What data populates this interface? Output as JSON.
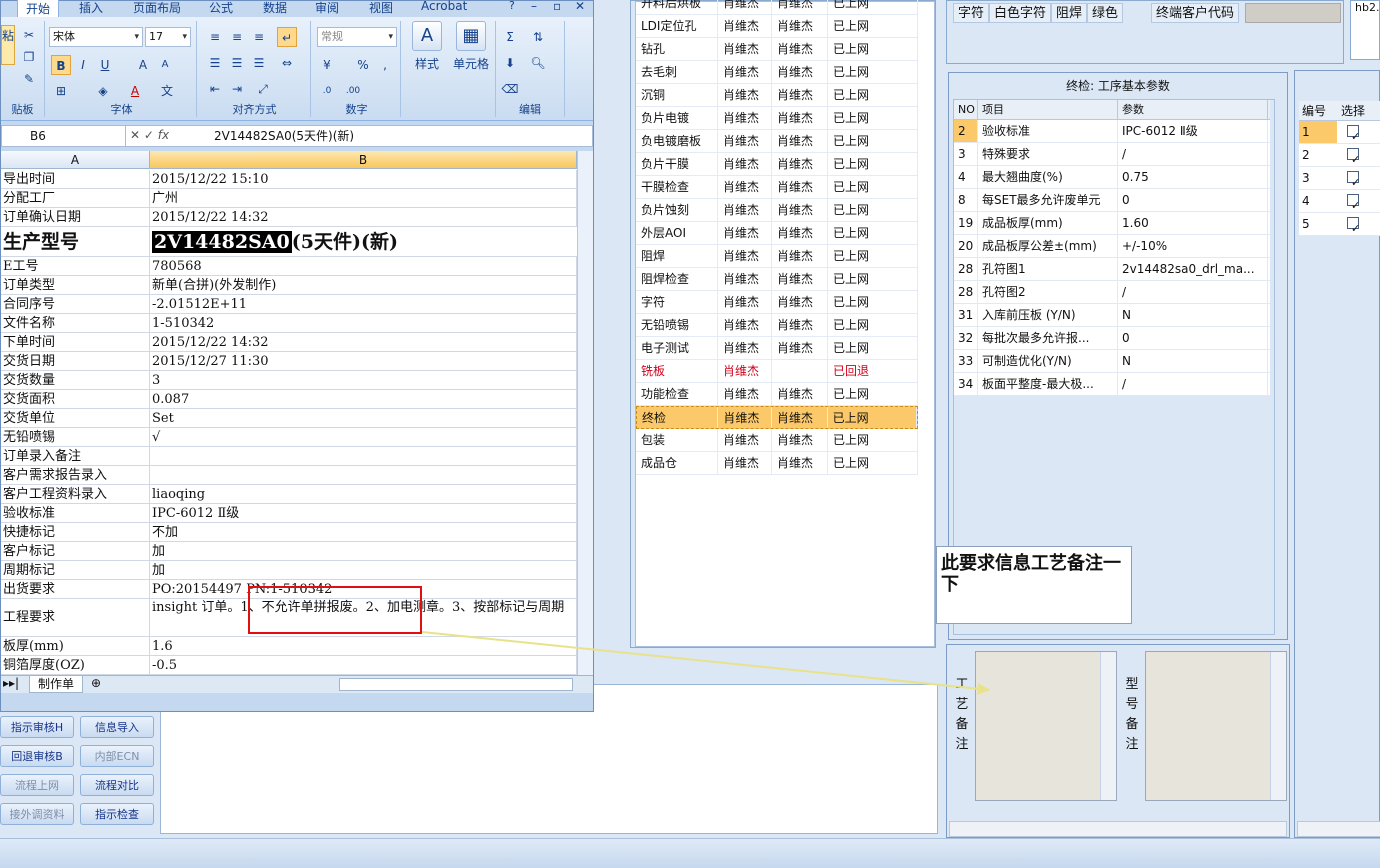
{
  "excel": {
    "tabs": [
      "开始",
      "插入",
      "页面布局",
      "公式",
      "数据",
      "审阅",
      "视图",
      "Acrobat"
    ],
    "ribbon": {
      "font_name": "宋体",
      "font_size": "17",
      "number_format": "常规",
      "groups": [
        "贴板",
        "字体",
        "对齐方式",
        "数字",
        "编辑"
      ],
      "style_label": "样式",
      "cell_label": "单元格",
      "paste_label": "粘贴"
    },
    "name_box": "B6",
    "formula": "2V14482SA0(5天件)(新)",
    "columns": [
      "A",
      "B"
    ],
    "rows": [
      {
        "a": "导出时间",
        "b": "2015/12/22 15:10"
      },
      {
        "a": "分配工厂",
        "b": "广州"
      },
      {
        "a": "订单确认日期",
        "b": "2015/12/22 14:32"
      },
      {
        "a": "生产型号",
        "b_hl": "2V14482SA0",
        "b": "(5天件)(新)"
      },
      {
        "a": "E工号",
        "b": "780568"
      },
      {
        "a": "订单类型",
        "b": "新单(合拼)(外发制作)"
      },
      {
        "a": "合同序号",
        "b": "-2.01512E+11"
      },
      {
        "a": "文件名称",
        "b": "1-510342"
      },
      {
        "a": "下单时间",
        "b": "2015/12/22 14:32"
      },
      {
        "a": "交货日期",
        "b": "2015/12/27 11:30"
      },
      {
        "a": "交货数量",
        "b": "3"
      },
      {
        "a": "交货面积",
        "b": "0.087"
      },
      {
        "a": "交货单位",
        "b": "Set"
      },
      {
        "a": "无铅喷锡",
        "b": "√"
      },
      {
        "a": "订单录入备注",
        "b": ""
      },
      {
        "a": "客户需求报告录入",
        "b": ""
      },
      {
        "a": "客户工程资料录入",
        "b": "liaoqing"
      },
      {
        "a": "验收标准",
        "b": "IPC-6012 Ⅱ级"
      },
      {
        "a": "快捷标记",
        "b": "不加"
      },
      {
        "a": "客户标记",
        "b": "加"
      },
      {
        "a": "周期标记",
        "b": "加"
      },
      {
        "a": "出货要求",
        "b": "PO:20154497 PN:1-510342"
      },
      {
        "a": "工程要求",
        "b": "insight 订单。1、不允许单拼报废。2、加电测章。3、按部标记与周期"
      },
      {
        "a": "板厚(mm)",
        "b": "1.6"
      },
      {
        "a": "铜箔厚度(OZ)",
        "b": "-0.5"
      }
    ],
    "sheet_tab": "制作单"
  },
  "left_buttons": [
    "指示审核H",
    "信息导入",
    "回退审核B",
    "内部ECN",
    "流程上网",
    "流程对比",
    "接外调资料",
    "指示检查"
  ],
  "process_list": [
    {
      "step": "开料后烘板",
      "p1": "肖维杰",
      "p2": "肖维杰",
      "status": "已上网"
    },
    {
      "step": "LDI定位孔",
      "p1": "肖维杰",
      "p2": "肖维杰",
      "status": "已上网"
    },
    {
      "step": "钻孔",
      "p1": "肖维杰",
      "p2": "肖维杰",
      "status": "已上网"
    },
    {
      "step": "去毛刺",
      "p1": "肖维杰",
      "p2": "肖维杰",
      "status": "已上网"
    },
    {
      "step": "沉铜",
      "p1": "肖维杰",
      "p2": "肖维杰",
      "status": "已上网"
    },
    {
      "step": "负片电镀",
      "p1": "肖维杰",
      "p2": "肖维杰",
      "status": "已上网"
    },
    {
      "step": "负电镀磨板",
      "p1": "肖维杰",
      "p2": "肖维杰",
      "status": "已上网"
    },
    {
      "step": "负片干膜",
      "p1": "肖维杰",
      "p2": "肖维杰",
      "status": "已上网"
    },
    {
      "step": "干膜检查",
      "p1": "肖维杰",
      "p2": "肖维杰",
      "status": "已上网"
    },
    {
      "step": "负片蚀刻",
      "p1": "肖维杰",
      "p2": "肖维杰",
      "status": "已上网"
    },
    {
      "step": "外层AOI",
      "p1": "肖维杰",
      "p2": "肖维杰",
      "status": "已上网"
    },
    {
      "step": "阻焊",
      "p1": "肖维杰",
      "p2": "肖维杰",
      "status": "已上网"
    },
    {
      "step": "阻焊检查",
      "p1": "肖维杰",
      "p2": "肖维杰",
      "status": "已上网"
    },
    {
      "step": "字符",
      "p1": "肖维杰",
      "p2": "肖维杰",
      "status": "已上网"
    },
    {
      "step": "无铅喷锡",
      "p1": "肖维杰",
      "p2": "肖维杰",
      "status": "已上网"
    },
    {
      "step": "电子测试",
      "p1": "肖维杰",
      "p2": "肖维杰",
      "status": "已上网"
    },
    {
      "step": "铣板",
      "p1": "肖维杰",
      "p2": "",
      "status": "已回退"
    },
    {
      "step": "功能检查",
      "p1": "肖维杰",
      "p2": "肖维杰",
      "status": "已上网"
    },
    {
      "step": "终检",
      "p1": "肖维杰",
      "p2": "肖维杰",
      "status": "已上网"
    },
    {
      "step": "包装",
      "p1": "肖维杰",
      "p2": "肖维杰",
      "status": "已上网"
    },
    {
      "step": "成品仓",
      "p1": "肖维杰",
      "p2": "肖维杰",
      "status": "已上网"
    }
  ],
  "top_right": {
    "chips": [
      "字符",
      "白色字符",
      "阻焊",
      "绿色",
      "终端客户代码"
    ],
    "box_text": "hb2."
  },
  "params": {
    "title": "终检: 工序基本参数",
    "headers": [
      "NO",
      "项目",
      "参数"
    ],
    "rows": [
      {
        "no": "2",
        "item": "验收标准",
        "val": "IPC-6012 Ⅱ级"
      },
      {
        "no": "3",
        "item": "特殊要求",
        "val": "/"
      },
      {
        "no": "4",
        "item": "最大翘曲度(%)",
        "val": "0.75"
      },
      {
        "no": "8",
        "item": "每SET最多允许废单元",
        "val": "0"
      },
      {
        "no": "19",
        "item": "成品板厚(mm)",
        "val": "1.60"
      },
      {
        "no": "20",
        "item": "成品板厚公差±(mm)",
        "val": "+/-10%"
      },
      {
        "no": "28",
        "item": "孔符图1",
        "val": "2v14482sa0_drl_ma..."
      },
      {
        "no": "28",
        "item": "孔符图2",
        "val": "/"
      },
      {
        "no": "31",
        "item": "入库前压板 (Y/N)",
        "val": "N"
      },
      {
        "no": "32",
        "item": "每批次最多允许报...",
        "val": "0"
      },
      {
        "no": "33",
        "item": "可制造优化(Y/N)",
        "val": "N"
      },
      {
        "no": "34",
        "item": "板面平整度-最大极...",
        "val": "/"
      }
    ]
  },
  "remarks": {
    "process_label": "工艺备注",
    "model_label": "型号备注"
  },
  "right_list": {
    "headers": [
      "编号",
      "选择"
    ],
    "rows": [
      "1",
      "2",
      "3",
      "4",
      "5"
    ]
  },
  "callout": "此要求信息工艺备注一下",
  "colors": {
    "accent_highlight": "#fcc96a",
    "annotation_red": "#e01010",
    "status_returned": "#d0001a"
  }
}
